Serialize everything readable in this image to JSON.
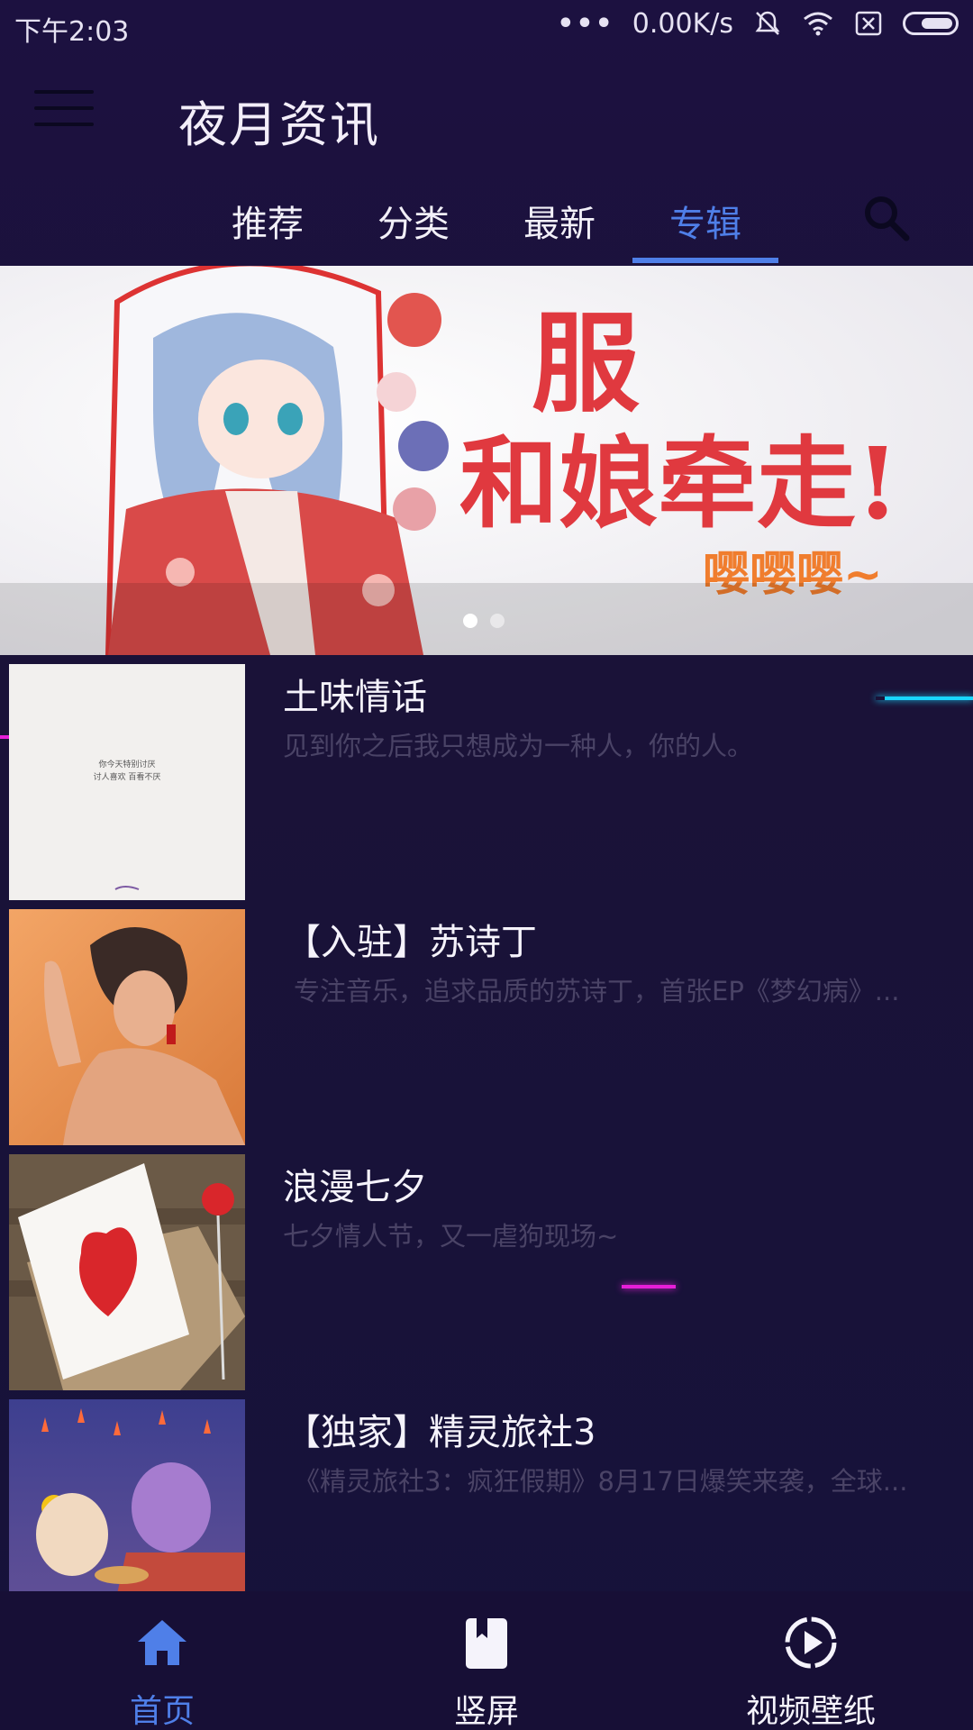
{
  "status_bar": {
    "time": "下午2:03",
    "more": "•••",
    "speed": "0.00K/s",
    "icons": [
      "mute-bell-icon",
      "wifi-icon",
      "sim-cross-icon",
      "battery-icon"
    ]
  },
  "app_bar": {
    "title": "夜月资讯",
    "menu_icon": "hamburger-menu-icon"
  },
  "tabs": [
    {
      "label": "推荐",
      "active": false
    },
    {
      "label": "分类",
      "active": false
    },
    {
      "label": "最新",
      "active": false
    },
    {
      "label": "专辑",
      "active": true
    }
  ],
  "search_icon": "search-icon",
  "banner": {
    "text_line1": "服",
    "text_line2": "和娘牵走!",
    "text_line3": "嘤嘤嘤~",
    "page_count": 2,
    "current_page": 1
  },
  "articles": [
    {
      "title": "土味情话",
      "desc": "见到你之后我只想成为一种人，你的人。",
      "thumb_text_1": "你今天特别讨厌",
      "thumb_text_2": "讨人喜欢 百看不厌"
    },
    {
      "title": "【入驻】苏诗丁",
      "desc": "专注音乐，追求品质的苏诗丁，首张EP《梦幻病》..."
    },
    {
      "title": "浪漫七夕",
      "desc": "七夕情人节，又一虐狗现场~"
    },
    {
      "title": "【独家】精灵旅社3",
      "desc": "《精灵旅社3：疯狂假期》8月17日爆笑来袭，全球..."
    }
  ],
  "bottom_nav": [
    {
      "label": "首页",
      "icon": "home-icon",
      "active": true
    },
    {
      "label": "竖屏",
      "icon": "bookmark-book-icon",
      "active": false
    },
    {
      "label": "视频壁纸",
      "icon": "video-play-icon",
      "active": false
    }
  ],
  "colors": {
    "background": "#1a1238",
    "accent": "#4f7fe8",
    "desc_text": "#4a4366"
  }
}
